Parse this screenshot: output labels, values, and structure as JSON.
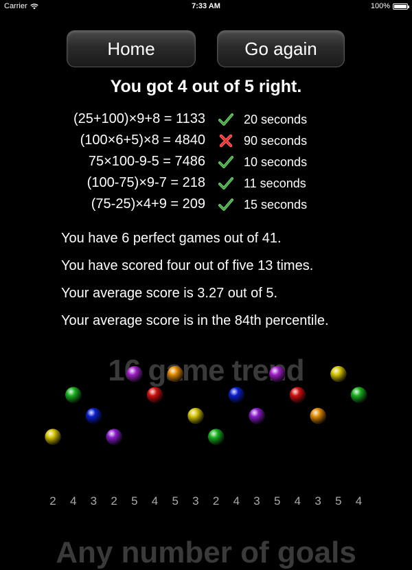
{
  "status_bar": {
    "carrier": "Carrier",
    "time": "7:33 AM",
    "battery": "100%",
    "battery_level": 1.0
  },
  "buttons": {
    "home": "Home",
    "go_again": "Go again"
  },
  "result_title": "You got 4 out of 5 right.",
  "problems": [
    {
      "expr": "(25+100)×9+8 = 1133",
      "correct": true,
      "time": "20 seconds"
    },
    {
      "expr": "(100×6+5)×8 = 4840",
      "correct": false,
      "time": "90 seconds"
    },
    {
      "expr": "75×100-9-5 = 7486",
      "correct": true,
      "time": "10 seconds"
    },
    {
      "expr": "(100-75)×9-7 = 218",
      "correct": true,
      "time": "11 seconds"
    },
    {
      "expr": "(75-25)×4+9 = 209",
      "correct": true,
      "time": "15 seconds"
    }
  ],
  "stats": [
    "You have 6 perfect games out of 41.",
    "You have scored four out of five 13 times.",
    "Your average score is 3.27 out of 5.",
    "Your average score is in the 84th percentile."
  ],
  "trend": {
    "title": "16 game trend",
    "colors": {
      "1": "#d4c400",
      "2": "#8a1ccc",
      "3": "#0a1ecc",
      "4": "#18b020",
      "5": "#d01010"
    },
    "chart_data": {
      "type": "scatter",
      "title": "16 game trend",
      "x": [
        1,
        2,
        3,
        4,
        5,
        6,
        7,
        8,
        9,
        10,
        11,
        12,
        13,
        14,
        15,
        16
      ],
      "y": [
        2,
        4,
        3,
        2,
        5,
        4,
        5,
        3,
        2,
        4,
        3,
        5,
        4,
        3,
        5,
        4
      ],
      "ylim": [
        1,
        5
      ],
      "ball_colors": [
        "#d4c400",
        "#18b020",
        "#0a1ecc",
        "#8a1ccc",
        "#a020c8",
        "#d01010",
        "#e08a00",
        "#d4c400",
        "#18b020",
        "#0a1ecc",
        "#8a1ccc",
        "#a020c8",
        "#d01010",
        "#e08a00",
        "#d4c400",
        "#18b020"
      ]
    }
  },
  "next_section_title": "Any number of goals"
}
